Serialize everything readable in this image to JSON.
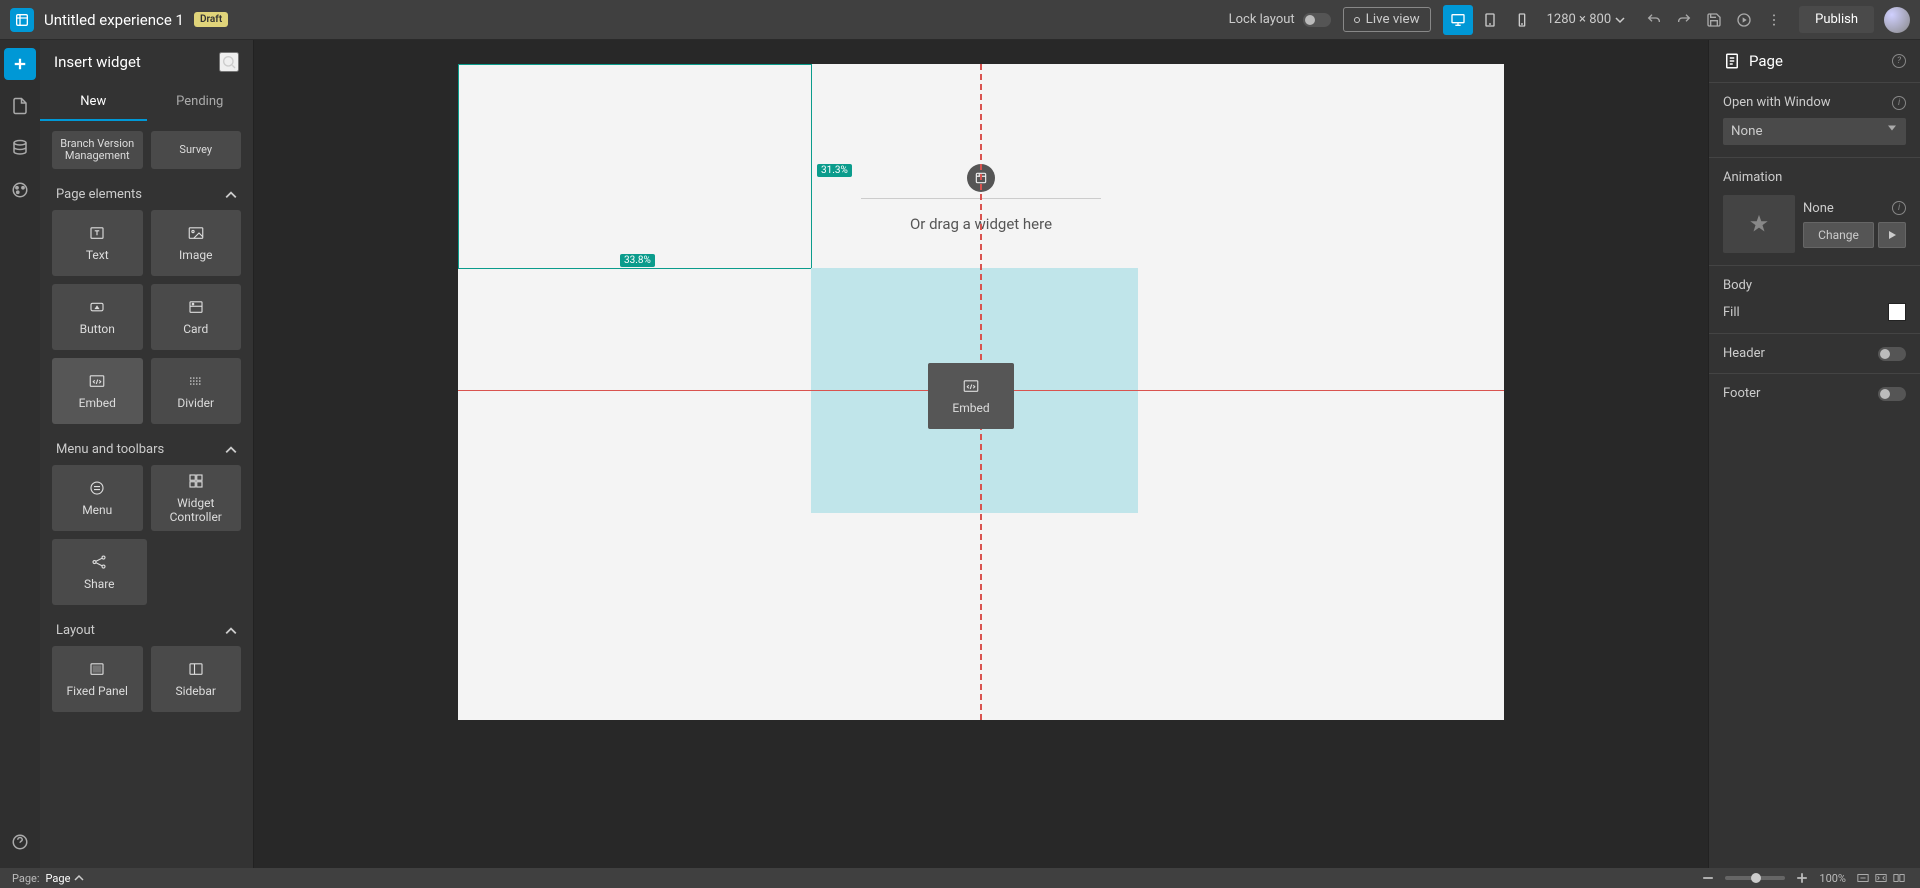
{
  "topbar": {
    "title": "Untitled experience 1",
    "draft_badge": "Draft",
    "lock_layout": "Lock layout",
    "live_view": "Live view",
    "dimensions": "1280 × 800",
    "publish": "Publish"
  },
  "leftpanel": {
    "title": "Insert widget",
    "tab_new": "New",
    "tab_pending": "Pending",
    "widget_branch": "Branch Version Management",
    "widget_survey": "Survey",
    "section_page_elements": "Page elements",
    "widget_text": "Text",
    "widget_image": "Image",
    "widget_button": "Button",
    "widget_card": "Card",
    "widget_embed": "Embed",
    "widget_divider": "Divider",
    "section_menu_toolbars": "Menu and toolbars",
    "widget_menu": "Menu",
    "widget_controller": "Widget Controller",
    "widget_share": "Share",
    "section_layout": "Layout",
    "widget_fixed_panel": "Fixed Panel",
    "widget_sidebar": "Sidebar"
  },
  "canvas": {
    "drop_hint": "Or drag a widget here",
    "badge_width": "33.8%",
    "badge_height": "31.3%",
    "drag_ghost": "Embed"
  },
  "rightpanel": {
    "title": "Page",
    "open_with_window": "Open with Window",
    "open_with_window_value": "None",
    "animation": "Animation",
    "animation_value": "None",
    "change": "Change",
    "body": "Body",
    "fill": "Fill",
    "header": "Header",
    "footer": "Footer"
  },
  "bottombar": {
    "page_label": "Page:",
    "page_value": "Page",
    "zoom": "100%"
  }
}
